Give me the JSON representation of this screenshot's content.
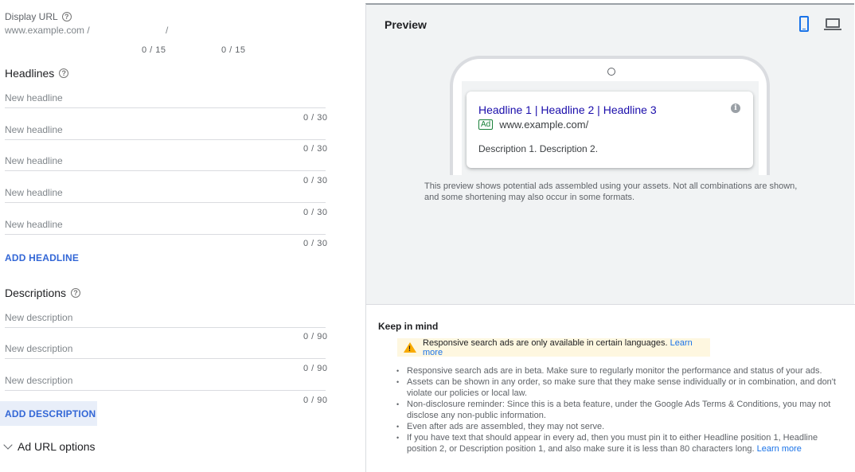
{
  "display_url": {
    "label": "Display URL",
    "base": "www.example.com /",
    "separator": "/",
    "path1_count": "0 / 15",
    "path2_count": "0 / 15"
  },
  "headlines": {
    "title": "Headlines",
    "fields": [
      {
        "placeholder": "New headline",
        "count": "0 / 30"
      },
      {
        "placeholder": "New headline",
        "count": "0 / 30"
      },
      {
        "placeholder": "New headline",
        "count": "0 / 30"
      },
      {
        "placeholder": "New headline",
        "count": "0 / 30"
      },
      {
        "placeholder": "New headline",
        "count": "0 / 30"
      }
    ],
    "add_label": "ADD HEADLINE"
  },
  "descriptions": {
    "title": "Descriptions",
    "fields": [
      {
        "placeholder": "New description",
        "count": "0 / 90"
      },
      {
        "placeholder": "New description",
        "count": "0 / 90"
      },
      {
        "placeholder": "New description",
        "count": "0 / 90"
      }
    ],
    "add_label": "ADD DESCRIPTION"
  },
  "url_options_label": "Ad URL options",
  "preview": {
    "title": "Preview",
    "ad": {
      "headline": "Headline 1 | Headline 2 | Headline 3",
      "badge": "Ad",
      "url": "www.example.com/",
      "description": "Description 1. Description 2."
    },
    "note": "This preview shows potential ads assembled using your assets. Not all combinations are shown, and some shortening may also occur in some formats."
  },
  "keep_in_mind": {
    "title": "Keep in mind",
    "warning": "Responsive search ads are only available in certain languages.",
    "warning_link": "Learn more",
    "bullets": [
      "Responsive search ads are in beta. Make sure to regularly monitor the performance and status of your ads.",
      "Assets can be shown in any order, so make sure that they make sense individually or in combination, and don't violate our policies or local law.",
      "Non-disclosure reminder: Since this is a beta feature, under the Google Ads Terms & Conditions, you may not disclose any non-public information.",
      "Even after ads are assembled, they may not serve.",
      "If you have text that should appear in every ad, then you must pin it to either Headline position 1, Headline position 2, or Description position 1, and also make sure it is less than 80 characters long."
    ],
    "last_bullet_link": "Learn more"
  },
  "colors": {
    "link_blue": "#3367d6",
    "ad_headline": "#1a0dab",
    "ad_badge_green": "#188038",
    "warning_bg": "#fef7e0",
    "warning_icon": "#f9ab00"
  }
}
